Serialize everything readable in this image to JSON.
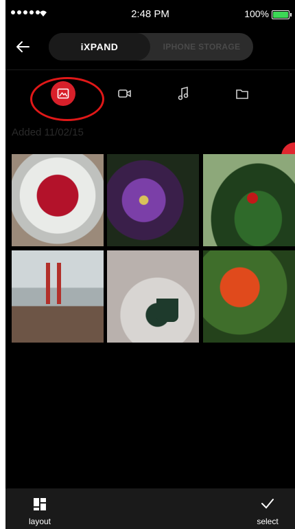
{
  "status_bar": {
    "time": "2:48 PM",
    "battery": "100%"
  },
  "header": {
    "segments": [
      {
        "label": "iXPAND",
        "active": true
      },
      {
        "label": "IPHONE STORAGE",
        "active": false
      }
    ]
  },
  "categories": [
    {
      "name": "photos",
      "icon": "photo-icon",
      "selected": true
    },
    {
      "name": "videos",
      "icon": "video-icon",
      "selected": false
    },
    {
      "name": "music",
      "icon": "music-icon",
      "selected": false
    },
    {
      "name": "files",
      "icon": "folder-icon",
      "selected": false
    }
  ],
  "section": {
    "date_label": "Added 11/02/15"
  },
  "grid": {
    "tiles": [
      "raspberries",
      "purple-flowers",
      "ladybug-leaf",
      "golden-gate-bridge",
      "coffee-mug",
      "tulips"
    ]
  },
  "bottom_bar": {
    "layout_label": "layout",
    "select_label": "select"
  },
  "colors": {
    "accent": "#d8202a",
    "background": "#000000",
    "bar": "#1a1a1a"
  }
}
